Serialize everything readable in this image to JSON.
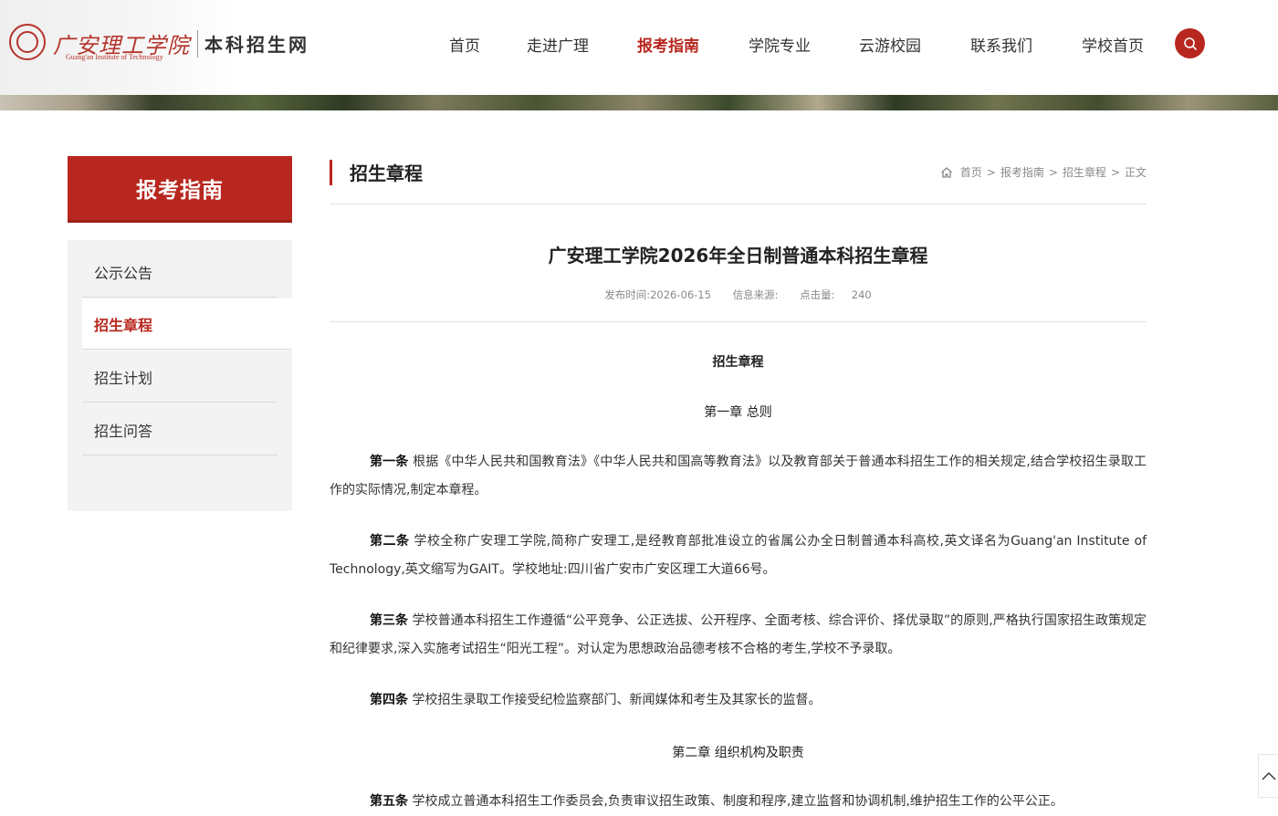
{
  "header": {
    "logo_cn": "广安理工学院",
    "logo_en": "Guang'an Institute of Technology",
    "site_name": "本科招生网",
    "nav": [
      {
        "label": "首页"
      },
      {
        "label": "走进广理"
      },
      {
        "label": "报考指南",
        "active": true
      },
      {
        "label": "学院专业"
      },
      {
        "label": "云游校园"
      },
      {
        "label": "联系我们"
      },
      {
        "label": "学校首页"
      }
    ],
    "search_icon": "search-icon",
    "accent_color": "#b8271f"
  },
  "sidebar": {
    "title": "报考指南",
    "items": [
      {
        "label": "公示公告"
      },
      {
        "label": "招生章程",
        "active": true
      },
      {
        "label": "招生计划"
      },
      {
        "label": "招生问答"
      }
    ]
  },
  "main": {
    "section_title": "招生章程",
    "breadcrumb": [
      "首页",
      "报考指南",
      "招生章程",
      "正文"
    ],
    "breadcrumb_sep": ">",
    "home_icon": "home-icon",
    "article": {
      "title": "广安理工学院2026年全日制普通本科招生章程",
      "meta": {
        "publish_label": "发布时间:",
        "publish_date": "2026-06-15",
        "source_label": "信息来源:",
        "clicks_label": "点击量:",
        "clicks": "240"
      },
      "heading": "招生章程",
      "chapter1": "第一章 总则",
      "chapter2": "第二章 组织机构及职责",
      "articles": [
        {
          "label": "第一条",
          "text": "根据《中华人民共和国教育法》《中华人民共和国高等教育法》以及教育部关于普通本科招生工作的相关规定,结合学校招生录取工作的实际情况,制定本章程。"
        },
        {
          "label": "第二条",
          "text": "学校全称广安理工学院,简称广安理工,是经教育部批准设立的省属公办全日制普通本科高校,英文译名为Guang'an Institute of Technology,英文缩写为GAIT。学校地址:四川省广安市广安区理工大道66号。"
        },
        {
          "label": "第三条",
          "text": "学校普通本科招生工作遵循“公平竞争、公正选拔、公开程序、全面考核、综合评价、择优录取”的原则,严格执行国家招生政策规定和纪律要求,深入实施考试招生“阳光工程”。对认定为思想政治品德考核不合格的考生,学校不予录取。"
        },
        {
          "label": "第四条",
          "text": "学校招生录取工作接受纪检监察部门、新闻媒体和考生及其家长的监督。"
        },
        {
          "label": "第五条",
          "text": "学校成立普通本科招生工作委员会,负责审议招生政策、制度和程序,建立监督和协调机制,维护招生工作的公平公正。"
        }
      ]
    }
  }
}
